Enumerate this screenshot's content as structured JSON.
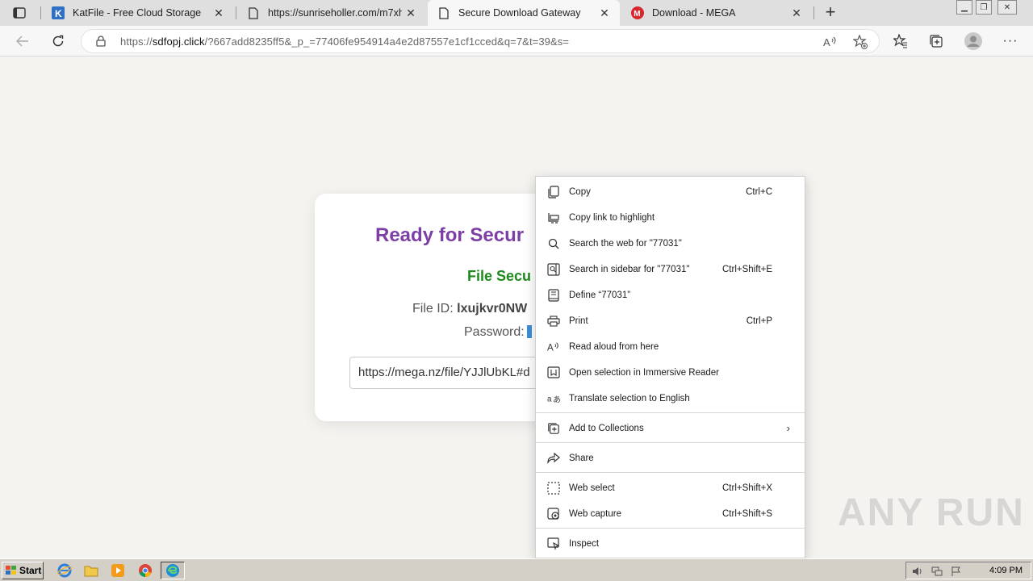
{
  "browser": {
    "tabs": [
      {
        "title": "KatFile - Free Cloud Storage",
        "icon": "katfile-icon",
        "active": false
      },
      {
        "title": "https://sunriseholler.com/m7xh",
        "icon": "page-icon",
        "active": false
      },
      {
        "title": "Secure Download Gateway",
        "icon": "page-icon",
        "active": true
      },
      {
        "title": "Download - MEGA",
        "icon": "mega-icon",
        "active": false
      }
    ],
    "url": {
      "prefix": "https://",
      "host": "sdfopj.click",
      "rest": "/?667add8235ff5&_p_=77406fe954914a4e2d87557e1cf1cced&q=7&t=39&s="
    }
  },
  "page": {
    "heading": "Ready for Secur",
    "subheading": "File Secu",
    "file_id_label": "File ID:",
    "file_id_value": "lxujkvr0NW",
    "password_label": "Password:",
    "link_value": "https://mega.nz/file/YJJlUbKL#d"
  },
  "context_menu": {
    "items": [
      {
        "label": "Copy",
        "shortcut": "Ctrl+C",
        "icon": "copy-icon"
      },
      {
        "label": "Copy link to highlight",
        "shortcut": "",
        "icon": "link-highlight-icon"
      },
      {
        "label": "Search the web for \"77031\"",
        "shortcut": "",
        "icon": "search-icon"
      },
      {
        "label": "Search in sidebar for \"77031\"",
        "shortcut": "Ctrl+Shift+E",
        "icon": "sidebar-search-icon"
      },
      {
        "label": "Define “77031”",
        "shortcut": "",
        "icon": "dictionary-icon"
      },
      {
        "label": "Print",
        "shortcut": "Ctrl+P",
        "icon": "print-icon"
      },
      {
        "label": "Read aloud from here",
        "shortcut": "",
        "icon": "read-aloud-icon"
      },
      {
        "label": "Open selection in Immersive Reader",
        "shortcut": "",
        "icon": "immersive-reader-icon"
      },
      {
        "label": "Translate selection to English",
        "shortcut": "",
        "icon": "translate-icon"
      },
      {
        "label": "Add to Collections",
        "shortcut": "",
        "icon": "collections-icon"
      },
      {
        "label": "Share",
        "shortcut": "",
        "icon": "share-icon"
      },
      {
        "label": "Web select",
        "shortcut": "Ctrl+Shift+X",
        "icon": "web-select-icon"
      },
      {
        "label": "Web capture",
        "shortcut": "Ctrl+Shift+S",
        "icon": "web-capture-icon"
      },
      {
        "label": "Inspect",
        "shortcut": "",
        "icon": "inspect-icon"
      }
    ]
  },
  "watermark": "ANY RUN",
  "taskbar": {
    "start_label": "Start",
    "clock": "4:09 PM"
  }
}
